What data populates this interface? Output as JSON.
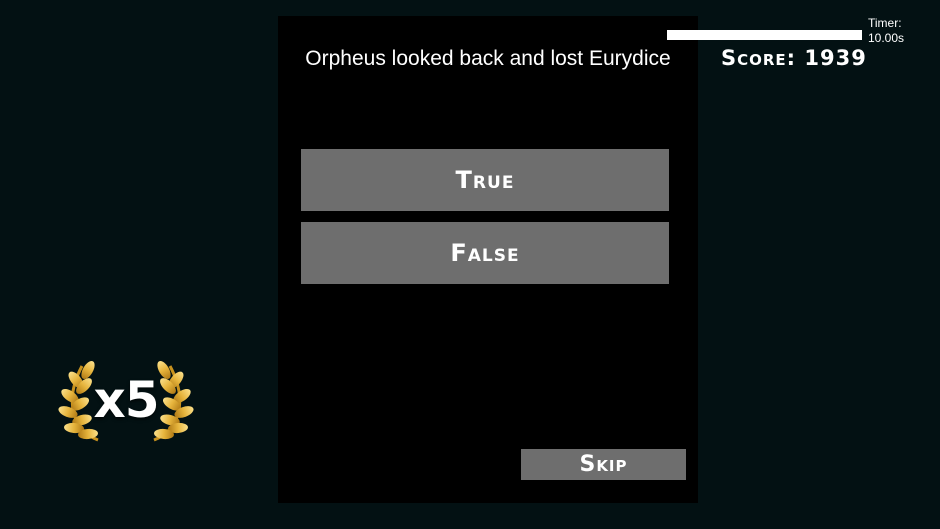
{
  "question": {
    "text": "Orpheus looked back and lost Eurydice"
  },
  "answers": {
    "true_label": "True",
    "false_label": "False"
  },
  "skip": {
    "label": "Skip"
  },
  "timer": {
    "label": "Timer:",
    "value": "10.00s",
    "fraction_remaining": 1.0
  },
  "score": {
    "label": "Score:",
    "value": "1939"
  },
  "multiplier": {
    "text": "x5",
    "icon": "laurel-wreath-icon"
  },
  "colors": {
    "background": "#031113",
    "panel": "#000000",
    "button": "#6e6e6e",
    "text": "#ffffff",
    "laurel_gold": "#e6b43c"
  }
}
